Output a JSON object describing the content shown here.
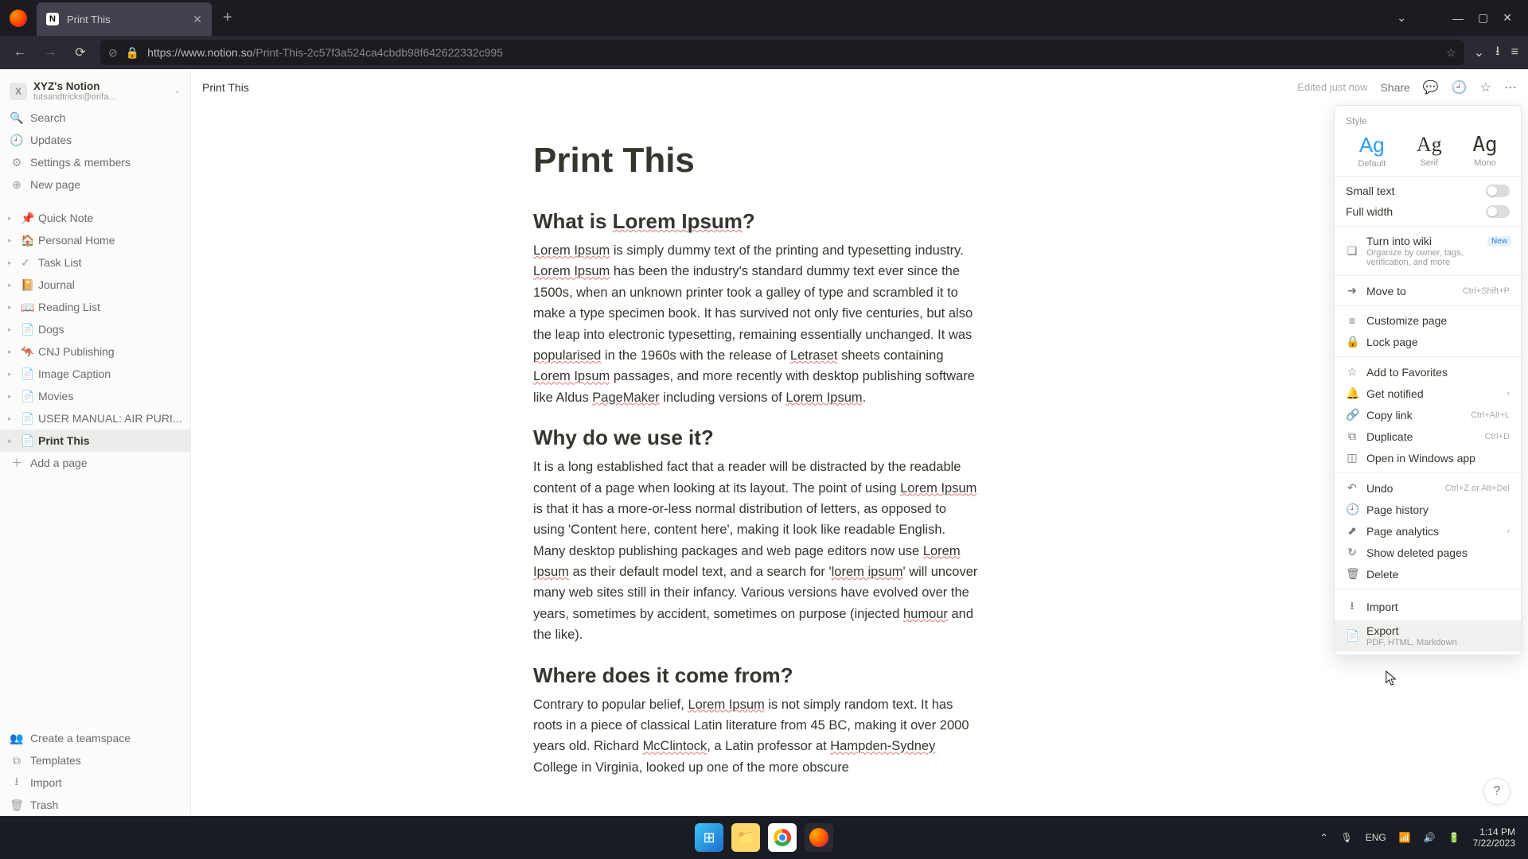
{
  "browser": {
    "tab_title": "Print This",
    "url_display_prefix": "https://www.notion.so",
    "url_display_path": "/Print-This-2c57f3a524ca4cbdb98f642622332c995"
  },
  "sidebar": {
    "workspace_name": "XYZ's Notion",
    "workspace_sub": "tutsandtricks@orifa...",
    "top_items": [
      {
        "icon": "🔍",
        "label": "Search"
      },
      {
        "icon": "🕘",
        "label": "Updates"
      },
      {
        "icon": "⚙",
        "label": "Settings & members"
      },
      {
        "icon": "⊕",
        "label": "New page"
      }
    ],
    "pages": [
      {
        "icon": "📌",
        "label": "Quick Note"
      },
      {
        "icon": "🏠",
        "label": "Personal Home"
      },
      {
        "icon": "✓",
        "label": "Task List"
      },
      {
        "icon": "📔",
        "label": "Journal"
      },
      {
        "icon": "📖",
        "label": "Reading List"
      },
      {
        "icon": "📄",
        "label": "Dogs"
      },
      {
        "icon": "🦘",
        "label": "CNJ Publishing"
      },
      {
        "icon": "📄",
        "label": "Image Caption"
      },
      {
        "icon": "📄",
        "label": "Movies"
      },
      {
        "icon": "📄",
        "label": "USER MANUAL: AIR PURI..."
      },
      {
        "icon": "📄",
        "label": "Print This",
        "active": true
      }
    ],
    "add_page": "Add a page",
    "footer_items": [
      {
        "icon": "👥",
        "label": "Create a teamspace"
      },
      {
        "icon": "⧉",
        "label": "Templates"
      },
      {
        "icon": "⭳",
        "label": "Import"
      },
      {
        "icon": "🗑",
        "label": "Trash"
      }
    ]
  },
  "topbar": {
    "breadcrumb": "Print This",
    "edited": "Edited just now",
    "share": "Share"
  },
  "article": {
    "title": "Print This",
    "h1": "What is ",
    "h1_link": "Lorem Ipsum",
    "h1_end": "?",
    "p1_a": "Lorem Ipsum",
    "p1_b": " is simply dummy text of the printing and  typesetting industry. ",
    "p1_c": "Lorem Ipsum",
    "p1_d": " has been the industry's standard dummy text ever since the 1500s, when an unknown printer took a galley of type and scrambled it to make a type specimen book. It has survived not only five centuries, but also the leap into electronic typesetting, remaining essentially unchanged. It was ",
    "p1_e": "popularised",
    "p1_f": " in the 1960s with the release of ",
    "p1_g": "Letraset",
    "p1_h": " sheets containing ",
    "p1_i": "Lorem Ipsum",
    "p1_j": " passages, and more recently with desktop publishing software like Aldus ",
    "p1_k": "PageMaker",
    "p1_l": " including versions of ",
    "p1_m": "Lorem Ipsum",
    "p1_n": ".",
    "h2": "Why do we use it?",
    "p2_a": "It is a long established fact that a reader will be distracted by the  readable content of a page when looking at its layout. The point of using ",
    "p2_b": "Lorem Ipsum",
    "p2_c": " is that it has a more-or-less normal distribution of letters, as opposed to using 'Content here, content here', making it look like readable English. Many desktop publishing packages and web page editors now use ",
    "p2_d": "Lorem Ipsum",
    "p2_e": " as their default model text, and a search for '",
    "p2_f": "lorem ipsum",
    "p2_g": "' will uncover many web sites still in their infancy. Various versions have evolved over the years, sometimes by accident, sometimes on purpose (injected ",
    "p2_h": "humour",
    "p2_i": " and the like).",
    "h3": "Where does it come from?",
    "p3_a": "Contrary to popular belief, ",
    "p3_b": "Lorem Ipsum",
    "p3_c": " is not simply random text. It  has roots in a piece of classical Latin literature from 45 BC, making it over 2000 years old. Richard ",
    "p3_d": "McClintock",
    "p3_e": ", a Latin professor at ",
    "p3_f": "Hampden-Sydney",
    "p3_g": " College in Virginia, looked up one of the more obscure"
  },
  "panel": {
    "style_hdr": "Style",
    "fonts": [
      {
        "ag": "Ag",
        "label": "Default",
        "sel": true,
        "cls": ""
      },
      {
        "ag": "Ag",
        "label": "Serif",
        "sel": false,
        "cls": "serif"
      },
      {
        "ag": "Ag",
        "label": "Mono",
        "sel": false,
        "cls": "mono"
      }
    ],
    "small_text": "Small text",
    "full_width": "Full width",
    "turn_wiki": "Turn into wiki",
    "turn_wiki_sub": "Organize by owner, tags, verification, and more",
    "new_badge": "New",
    "move_to": "Move to",
    "move_kb": "Ctrl+Shift+P",
    "customize": "Customize page",
    "lock": "Lock page",
    "fav": "Add to Favorites",
    "notif": "Get notified",
    "copy": "Copy link",
    "copy_kb": "Ctrl+Alt+L",
    "dupl": "Duplicate",
    "dupl_kb": "Ctrl+D",
    "open_app": "Open in Windows app",
    "undo": "Undo",
    "undo_kb": "Ctrl+Z or Alt+Del",
    "history": "Page history",
    "analytics": "Page analytics",
    "show_del": "Show deleted pages",
    "delete": "Delete",
    "import": "Import",
    "export": "Export",
    "export_sub": "PDF, HTML, Markdown"
  },
  "taskbar": {
    "lang": "ENG",
    "time": "1:14 PM",
    "date": "7/22/2023"
  }
}
